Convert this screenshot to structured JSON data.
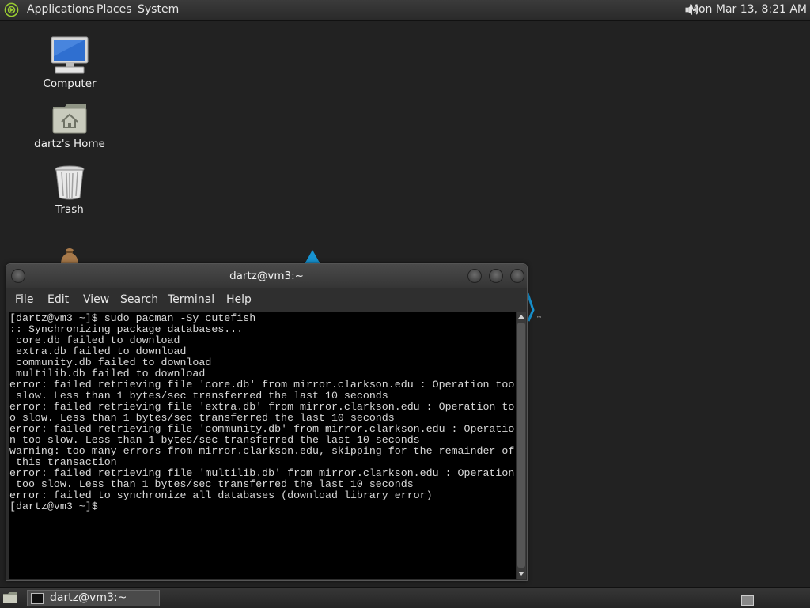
{
  "top_panel": {
    "menus": [
      "Applications",
      "Places",
      "System"
    ],
    "clock": "Mon Mar 13,  8:21 AM"
  },
  "desktop": {
    "icons": [
      {
        "label": "Computer",
        "icon": "computer-icon"
      },
      {
        "label": "dartz's Home",
        "icon": "home-folder-icon"
      },
      {
        "label": "Trash",
        "icon": "trash-icon"
      }
    ]
  },
  "terminal": {
    "title": "dartz@vm3:~",
    "menus": [
      "File",
      "Edit",
      "View",
      "Search",
      "Terminal",
      "Help"
    ],
    "lines": [
      "[dartz@vm3 ~]$ sudo pacman -Sy cutefish",
      ":: Synchronizing package databases...",
      " core.db failed to download",
      " extra.db failed to download",
      " community.db failed to download",
      " multilib.db failed to download",
      "error: failed retrieving file 'core.db' from mirror.clarkson.edu : Operation too",
      " slow. Less than 1 bytes/sec transferred the last 10 seconds",
      "error: failed retrieving file 'extra.db' from mirror.clarkson.edu : Operation to",
      "o slow. Less than 1 bytes/sec transferred the last 10 seconds",
      "error: failed retrieving file 'community.db' from mirror.clarkson.edu : Operatio",
      "n too slow. Less than 1 bytes/sec transferred the last 10 seconds",
      "warning: too many errors from mirror.clarkson.edu, skipping for the remainder of",
      " this transaction",
      "error: failed retrieving file 'multilib.db' from mirror.clarkson.edu : Operation",
      " too slow. Less than 1 bytes/sec transferred the last 10 seconds",
      "error: failed to synchronize all databases (download library error)",
      "[dartz@vm3 ~]$"
    ]
  },
  "taskbar": {
    "window_label": "dartz@vm3:~"
  }
}
